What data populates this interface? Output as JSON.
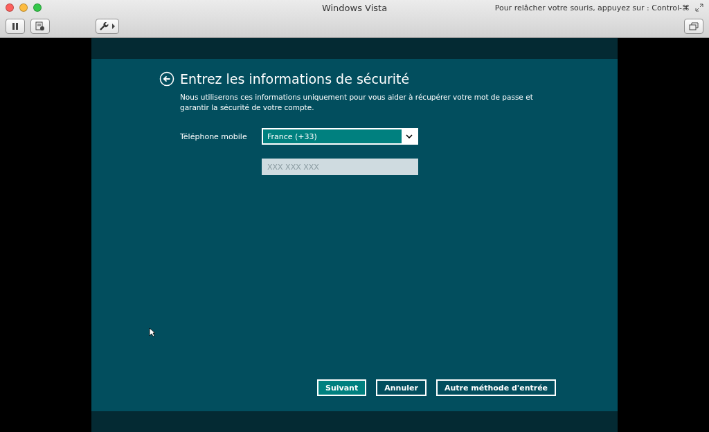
{
  "window": {
    "title": "Windows Vista",
    "hint": "Pour relâcher votre souris, appuyez sur : Control-⌘"
  },
  "setup": {
    "title": "Entrez les informations de sécurité",
    "description": "Nous utiliserons ces informations uniquement pour vous aider à récupérer votre mot de passe et garantir la sécurité de votre compte.",
    "phone_label": "Téléphone mobile",
    "country": {
      "value": "France (+33)"
    },
    "number": {
      "placeholder": "XXX XXX XXX"
    },
    "buttons": [
      {
        "label": "Suivant",
        "kind": "primary"
      },
      {
        "label": "Annuler",
        "kind": "secondary"
      },
      {
        "label": "Autre méthode d'entrée",
        "kind": "secondary"
      }
    ]
  }
}
